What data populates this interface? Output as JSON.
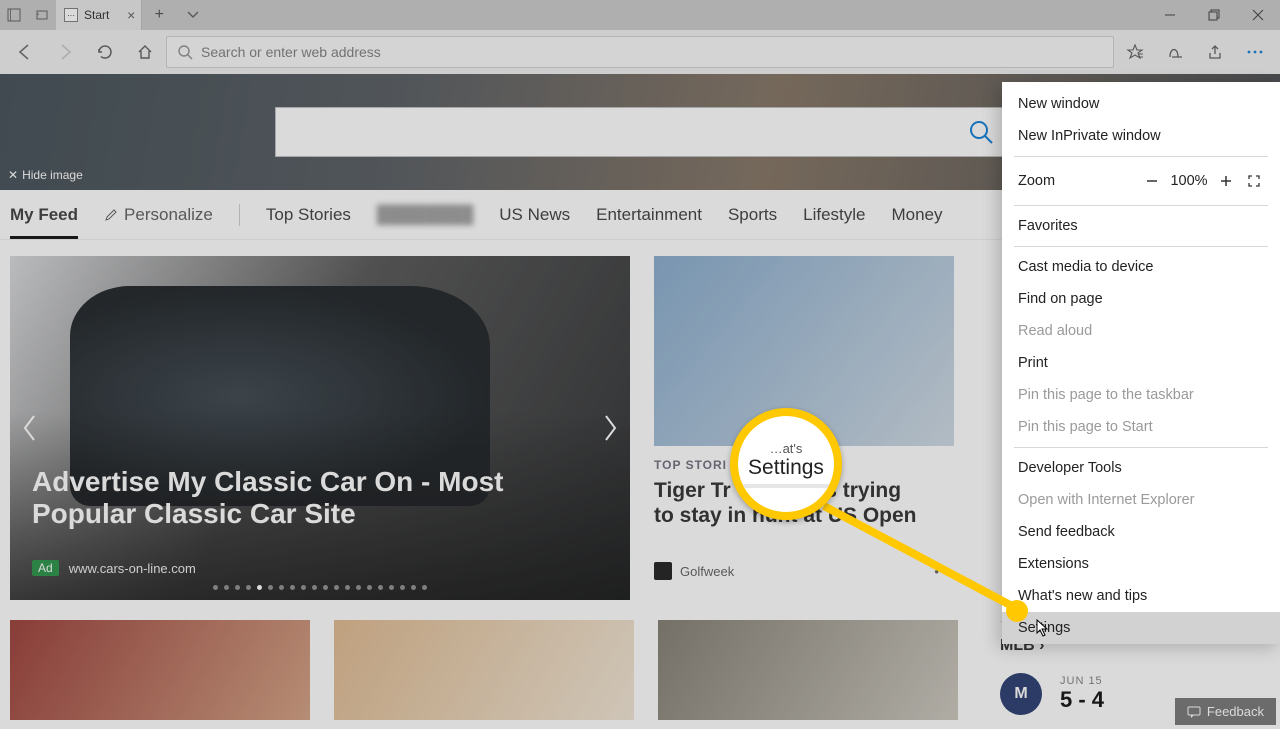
{
  "titlebar": {
    "tab_title": "Start"
  },
  "toolbar": {
    "placeholder": "Search or enter web address"
  },
  "hero": {
    "hide_image": "Hide image"
  },
  "feednav": {
    "my_feed": "My Feed",
    "personalize": "Personalize",
    "items": [
      "Top Stories",
      "US News",
      "Entertainment",
      "Sports",
      "Lifestyle",
      "Money"
    ]
  },
  "carousel": {
    "headline": "Advertise My Classic Car On - Most Popular Classic Car Site",
    "ad_label": "Ad",
    "source": "www.cars-on-line.com"
  },
  "card": {
    "kicker_prefix": "TOP STORI",
    "title_line1": "Tiger Tr",
    "title_mid": "ds trying",
    "title_line2": "to stay in hunt at US Open",
    "source": "Golfweek"
  },
  "side": {
    "mlb": "MLB",
    "date": "JUN 15",
    "score": "5 - 4",
    "team_initial": "M"
  },
  "feedback": {
    "label": "Feedback"
  },
  "callout": {
    "top": "…at's",
    "main": "Settings"
  },
  "menu": {
    "new_window": "New window",
    "new_inprivate": "New InPrivate window",
    "zoom_label": "Zoom",
    "zoom_value": "100%",
    "favorites": "Favorites",
    "cast": "Cast media to device",
    "find": "Find on page",
    "read_aloud": "Read aloud",
    "print": "Print",
    "pin_taskbar": "Pin this page to the taskbar",
    "pin_start": "Pin this page to Start",
    "devtools": "Developer Tools",
    "open_ie": "Open with Internet Explorer",
    "send_feedback": "Send feedback",
    "extensions": "Extensions",
    "whats_new": "What's new and tips",
    "settings": "Settings"
  }
}
